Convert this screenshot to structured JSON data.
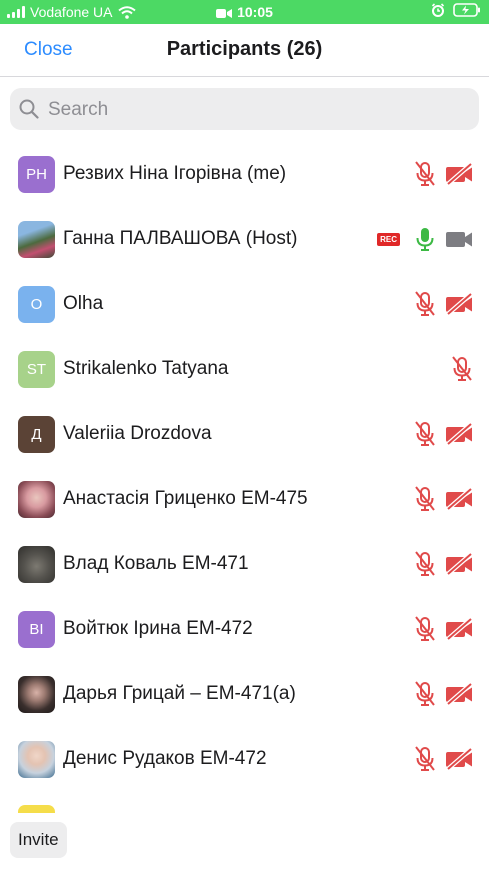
{
  "status_bar": {
    "carrier": "Vodafone UA",
    "time": "10:05"
  },
  "header": {
    "close_label": "Close",
    "title": "Participants (26)"
  },
  "search": {
    "placeholder": "Search"
  },
  "participants": [
    {
      "initials": "РН",
      "name": "Резвих Ніна Ігорівна (me)",
      "avatar_color": "#9a6fcf",
      "mic": "muted",
      "video": "off"
    },
    {
      "initials": "",
      "name": "Ганна ПАЛВАШОВА (Host)",
      "avatar_color": "#5a6b52",
      "recording": "REC",
      "mic": "on",
      "video": "on"
    },
    {
      "initials": "O",
      "name": "Olha",
      "avatar_color": "#7ab2ee",
      "mic": "muted",
      "video": "off"
    },
    {
      "initials": "ST",
      "name": "Strikalenko Tatyana",
      "avatar_color": "#a7d28a",
      "mic": "muted"
    },
    {
      "initials": "Д",
      "name": "Valeriia Drozdova",
      "avatar_color": "#5b4336",
      "mic": "muted",
      "video": "off"
    },
    {
      "initials": "",
      "name": "Анастасія Гриценко ЕМ-475",
      "avatar_color": "#c98b90",
      "mic": "muted",
      "video": "off"
    },
    {
      "initials": "",
      "name": "Влад Коваль ЕМ-471",
      "avatar_color": "#4b4a47",
      "mic": "muted",
      "video": "off"
    },
    {
      "initials": "BI",
      "name": "Войтюк Ірина ЕМ-472",
      "avatar_color": "#9a6fcf",
      "mic": "muted",
      "video": "off"
    },
    {
      "initials": "",
      "name": "Дарья Грицай – ЕМ-471(а)",
      "avatar_color": "#3e3432",
      "mic": "muted",
      "video": "off"
    },
    {
      "initials": "",
      "name": "Денис Рудаков ЕМ-472",
      "avatar_color": "#b9c6d6",
      "mic": "muted",
      "video": "off"
    }
  ],
  "footer": {
    "invite_label": "Invite"
  },
  "colors": {
    "status_bar": "#4cd964",
    "accent": "#2d8cff",
    "muted_icon": "#e04a4a",
    "mic_on": "#3cb944",
    "video_on": "#7d7d82",
    "rec_badge": "#e02828"
  },
  "icons": {
    "mic_muted": "mic-muted-icon",
    "mic_on": "mic-on-icon",
    "video_off": "video-off-icon",
    "video_on": "video-on-icon",
    "search": "search-icon"
  }
}
